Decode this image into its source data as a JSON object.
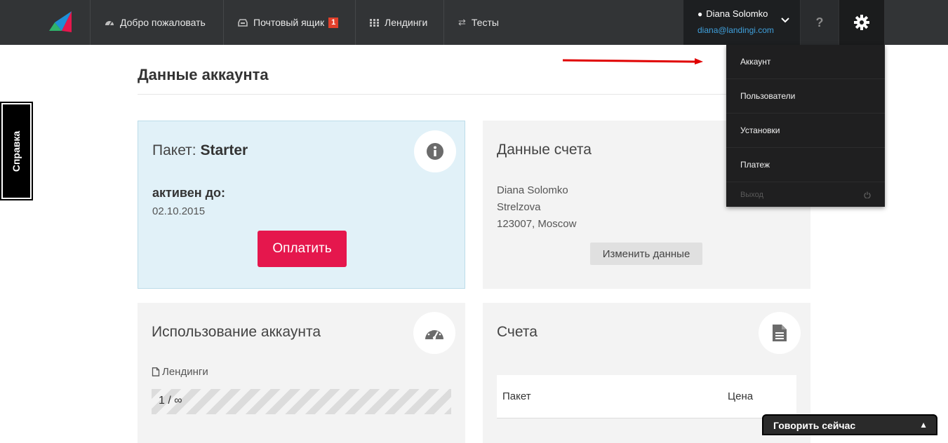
{
  "nav": {
    "welcome": "Добро пожаловать",
    "mailbox": "Почтовый ящик",
    "mailbox_badge": "1",
    "landings": "Лендинги",
    "tests": "Тесты"
  },
  "user": {
    "name": "Diana Solomko",
    "email": "diana@landingi.com"
  },
  "help_label": "?",
  "dropdown": {
    "items": [
      "Аккаунт",
      "Пользователи",
      "Установки",
      "Платеж"
    ],
    "logout": "Выход"
  },
  "side_help": "Справка",
  "page": {
    "title": "Данные аккаунта"
  },
  "plan": {
    "prefix": "Пакет:",
    "name": "Starter",
    "active_label": "активен до:",
    "active_date": "02.10.2015",
    "pay_button": "Оплатить"
  },
  "billing": {
    "heading": "Данные счета",
    "lines": [
      "Diana Solomko",
      "Strelzova",
      "123007, Moscow"
    ],
    "edit_button": "Изменить данные"
  },
  "usage": {
    "heading": "Использование аккаунта",
    "label": "Лендинги",
    "value": "1 / ∞"
  },
  "invoices": {
    "heading": "Счета",
    "col_package": "Пакет",
    "col_price": "Цена"
  },
  "chat": {
    "label": "Говорить сейчас"
  },
  "colors": {
    "accent_pink": "#e5174d",
    "link_blue": "#3fa0dc",
    "nav_bg": "#323436",
    "badge_red": "#e2402b"
  }
}
